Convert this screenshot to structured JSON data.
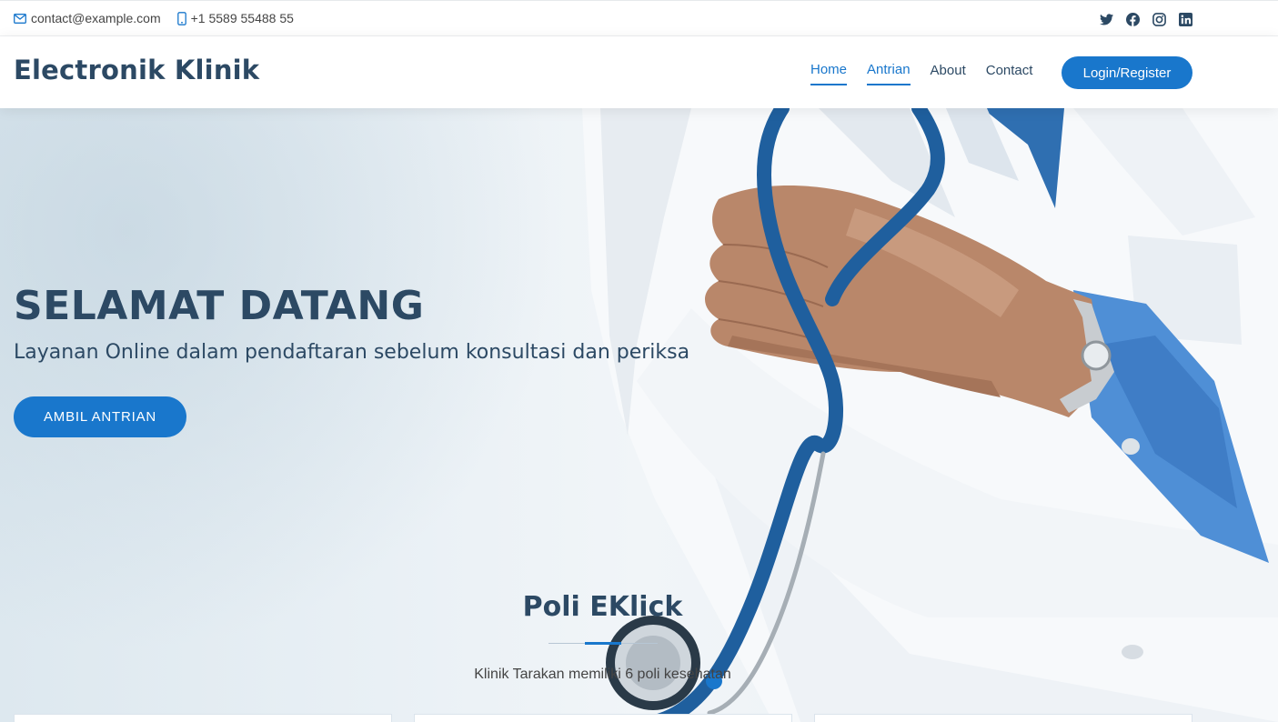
{
  "topbar": {
    "email": "contact@example.com",
    "phone": "+1 5589 55488 55",
    "social": [
      "twitter-icon",
      "facebook-icon",
      "instagram-icon",
      "linkedin-icon"
    ]
  },
  "header": {
    "logo": "Electronik Klinik",
    "nav": {
      "home": "Home",
      "antrian": "Antrian",
      "about": "About",
      "contact": "Contact"
    },
    "login_label": "Login/Register"
  },
  "hero": {
    "title": "SELAMAT DATANG",
    "subtitle": "Layanan Online dalam pendaftaran sebelum konsultasi dan periksa",
    "button_label": "AMBIL ANTRIAN"
  },
  "section": {
    "title": "Poli EKlick",
    "description": "Klinik Tarakan memiliki 6 poli kesehatan"
  },
  "colors": {
    "accent": "#1977cc",
    "text": "#2c4964"
  }
}
